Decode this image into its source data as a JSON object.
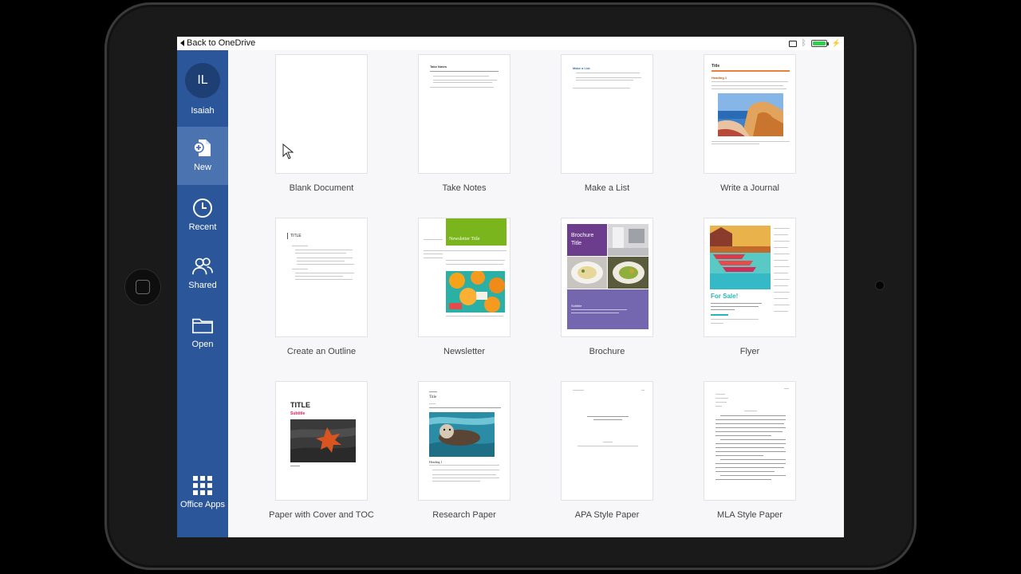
{
  "status": {
    "back_label": "Back to OneDrive"
  },
  "sidebar": {
    "user": {
      "initials": "IL",
      "name": "Isaiah"
    },
    "items": [
      {
        "label": "New",
        "icon": "new-document-icon"
      },
      {
        "label": "Recent",
        "icon": "clock-icon"
      },
      {
        "label": "Shared",
        "icon": "people-icon"
      },
      {
        "label": "Open",
        "icon": "folder-icon"
      },
      {
        "label": "Office Apps",
        "icon": "app-grid-icon"
      }
    ]
  },
  "templates": [
    {
      "label": "Blank Document",
      "id": "blank-document"
    },
    {
      "label": "Take Notes",
      "id": "take-notes",
      "thumb_title": "Take Notes"
    },
    {
      "label": "Make a List",
      "id": "make-a-list",
      "thumb_title": "Make a List"
    },
    {
      "label": "Write a Journal",
      "id": "write-a-journal",
      "thumb_title": "Title",
      "thumb_heading": "Heading 1"
    },
    {
      "label": "Create an Outline",
      "id": "create-an-outline",
      "thumb_title": "TITLE"
    },
    {
      "label": "Newsletter",
      "id": "newsletter",
      "thumb_title": "Newsletter Title"
    },
    {
      "label": "Brochure",
      "id": "brochure",
      "thumb_title": "Brochure Title",
      "thumb_sub": "Subtitle"
    },
    {
      "label": "Flyer",
      "id": "flyer",
      "thumb_title": "For Sale!"
    },
    {
      "label": "Paper with Cover and TOC",
      "id": "paper-with-cover-and-toc",
      "thumb_title": "TITLE",
      "thumb_sub": "Subtitle"
    },
    {
      "label": "Research Paper",
      "id": "research-paper",
      "thumb_title": "Title",
      "thumb_heading": "Heading 1"
    },
    {
      "label": "APA Style Paper",
      "id": "apa-style-paper"
    },
    {
      "label": "MLA Style Paper",
      "id": "mla-style-paper"
    }
  ]
}
